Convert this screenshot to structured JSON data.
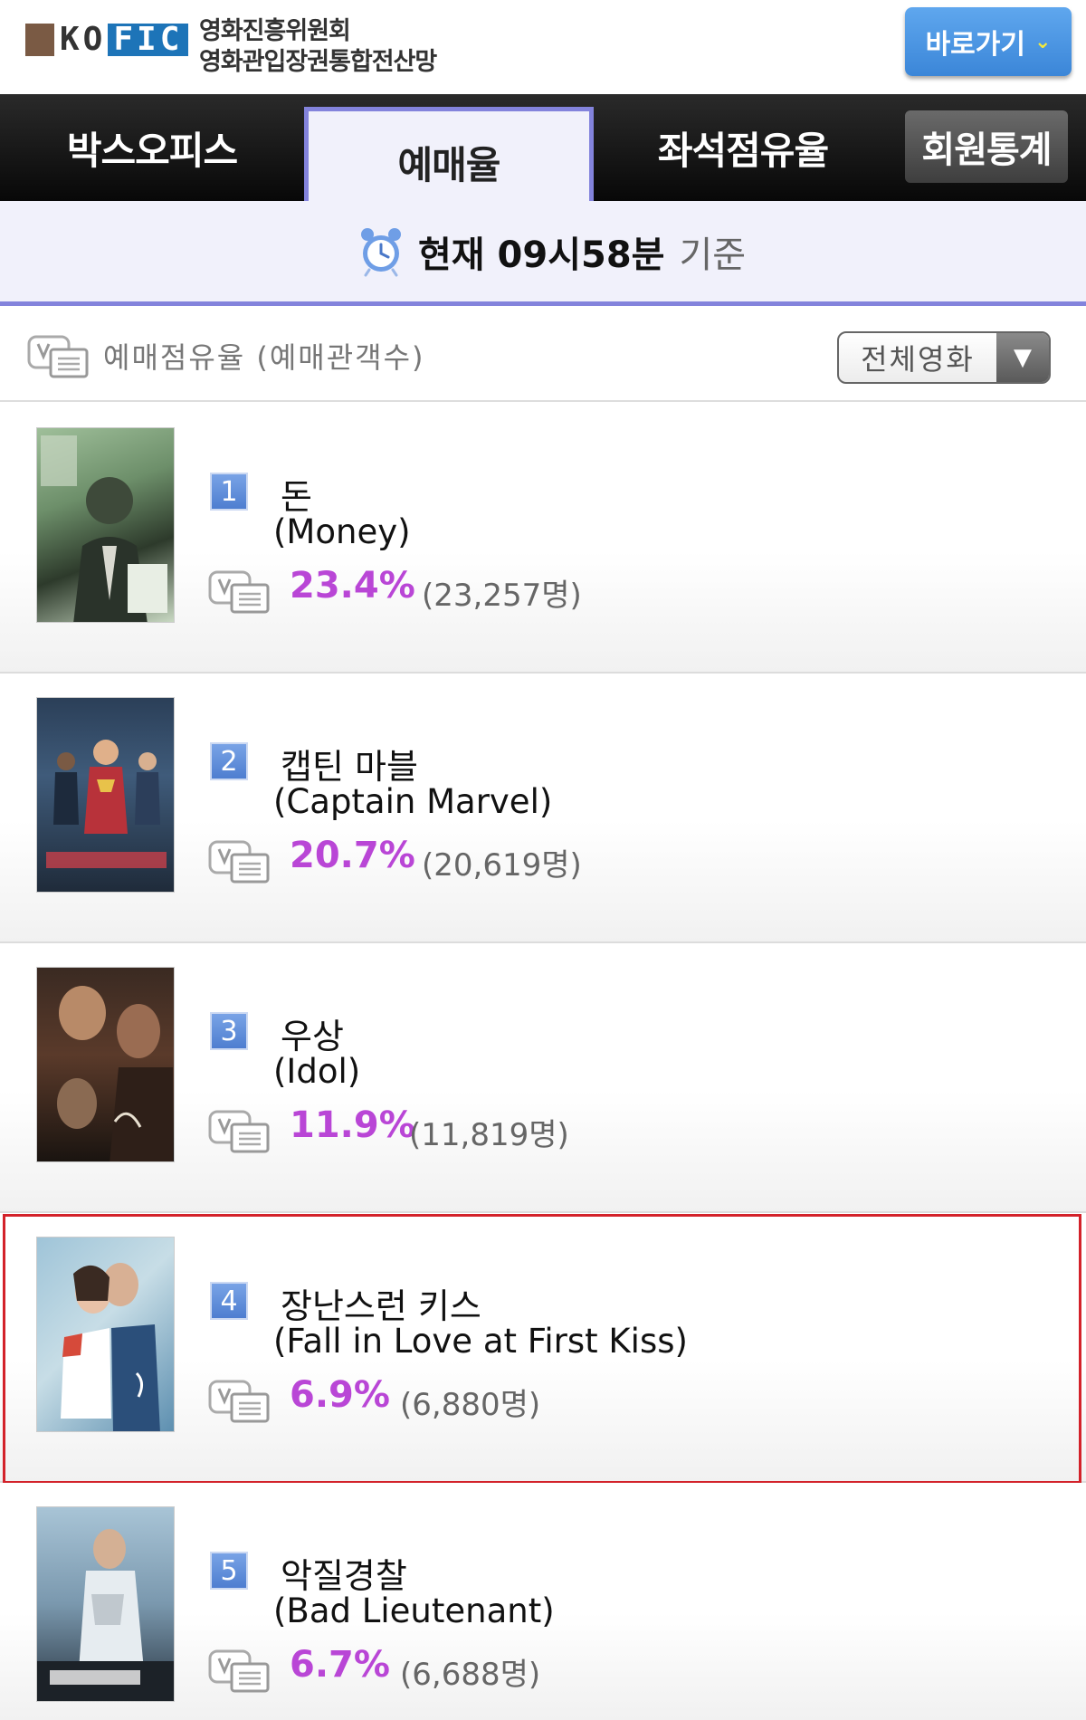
{
  "header": {
    "logo_ko": "KO",
    "logo_fic": "FIC",
    "org_line1": "영화진흥위원회",
    "org_line2": "영화관입장권통합전산망",
    "goto_label": "바로가기",
    "goto_chevron": "⌄"
  },
  "tabs": [
    {
      "label": "박스오피스",
      "active": false
    },
    {
      "label": "예매율",
      "active": true
    },
    {
      "label": "좌석점유율",
      "active": false
    },
    {
      "label": "회원통계",
      "active": false
    }
  ],
  "timestrip": {
    "time_text": "현재 09시58분",
    "suffix": "기준",
    "icon": "alarm-clock-icon"
  },
  "filter": {
    "label": "예매점유율 (예매관객수)",
    "icon": "ticket-icon",
    "select_value": "전체영화",
    "select_arrow": "▼"
  },
  "movies": [
    {
      "rank": "1",
      "title_ko": "돈",
      "title_en": "(Money)",
      "rate": "23.4%",
      "count": "(23,257명)",
      "highlighted": false
    },
    {
      "rank": "2",
      "title_ko": "캡틴 마블",
      "title_en": "(Captain Marvel)",
      "rate": "20.7%",
      "count": "(20,619명)",
      "highlighted": false
    },
    {
      "rank": "3",
      "title_ko": "우상",
      "title_en": "(Idol)",
      "rate": "11.9%",
      "count": "(11,819명)",
      "highlighted": false
    },
    {
      "rank": "4",
      "title_ko": "장난스런 키스",
      "title_en": "(Fall in Love at First Kiss)",
      "rate": "6.9%",
      "count": "(6,880명)",
      "highlighted": true
    },
    {
      "rank": "5",
      "title_ko": "악질경찰",
      "title_en": "(Bad Lieutenant)",
      "rate": "6.7%",
      "count": "(6,688명)",
      "highlighted": false
    }
  ],
  "colors": {
    "accent_purple": "#8383dc",
    "rate_color": "#b946d6",
    "highlight_border": "#d3222a",
    "rank_badge": "#5a88d6"
  }
}
